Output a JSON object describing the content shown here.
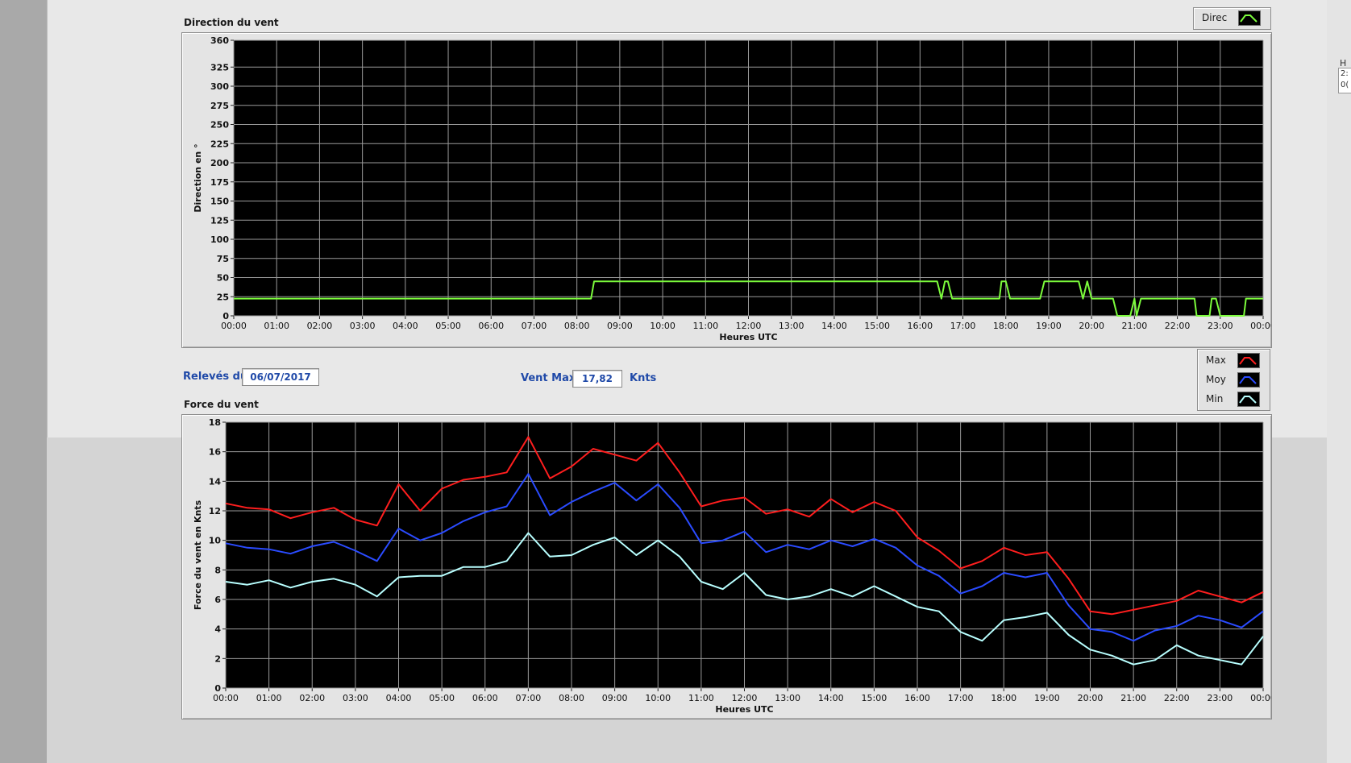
{
  "charts": {
    "direction": {
      "title": "Direction du vent",
      "legend": [
        {
          "label": "Direc",
          "color": "#7cfc3c"
        }
      ]
    },
    "force": {
      "title": "Force du vent",
      "legend": [
        {
          "label": "Max",
          "color": "#ff1e1e"
        },
        {
          "label": "Moy",
          "color": "#2a4bff"
        },
        {
          "label": "Min",
          "color": "#b8ffff"
        }
      ]
    }
  },
  "controls": {
    "releves_label": "Relevés du",
    "date_value": "06/07/2017",
    "vent_max_label": "Vent Max",
    "vent_max_value": "17,82",
    "unit_label": "Knts"
  },
  "side_strip": {
    "labels": [
      "H",
      "2:",
      "0("
    ]
  },
  "chart_data": [
    {
      "id": "direction",
      "type": "line",
      "title": "Direction du vent",
      "xlabel": "Heures UTC",
      "ylabel": "Direction en °",
      "xlim": [
        0,
        24
      ],
      "ylim": [
        0,
        360
      ],
      "xticks": [
        "00:00",
        "01:00",
        "02:00",
        "03:00",
        "04:00",
        "05:00",
        "06:00",
        "07:00",
        "08:00",
        "09:00",
        "10:00",
        "11:00",
        "12:00",
        "13:00",
        "14:00",
        "15:00",
        "16:00",
        "17:00",
        "18:00",
        "19:00",
        "20:00",
        "21:00",
        "22:00",
        "23:00",
        "00:00"
      ],
      "yticks": [
        0,
        25,
        50,
        75,
        100,
        125,
        150,
        175,
        200,
        225,
        250,
        275,
        300,
        325,
        360
      ],
      "grid": true,
      "legend_position": "top-right",
      "series": [
        {
          "name": "Direc",
          "color": "#7cfc3c",
          "x": [
            0,
            8.33,
            8.4,
            16.4,
            16.5,
            16.58,
            16.65,
            16.75,
            17.85,
            17.9,
            18.0,
            18.1,
            18.8,
            18.9,
            19.7,
            19.8,
            19.9,
            20.0,
            20.1,
            20.5,
            20.6,
            20.9,
            21.0,
            21.05,
            21.15,
            21.25,
            21.3,
            22.4,
            22.45,
            22.75,
            22.8,
            22.9,
            23.0,
            23.1,
            23.55,
            23.6,
            24.0
          ],
          "y": [
            22.5,
            22.5,
            45,
            45,
            22.5,
            45,
            45,
            22.5,
            22.5,
            45,
            45,
            22.5,
            22.5,
            45,
            45,
            22.5,
            45,
            22.5,
            22.5,
            22.5,
            0,
            0,
            22.5,
            0,
            22.5,
            22.5,
            22.5,
            22.5,
            0,
            0,
            22.5,
            22.5,
            0,
            0,
            0,
            22.5,
            22.5
          ]
        }
      ]
    },
    {
      "id": "force",
      "type": "line",
      "title": "Force du vent",
      "xlabel": "Heures UTC",
      "ylabel": "Force du vent en Knts",
      "xlim": [
        0,
        24
      ],
      "ylim": [
        0,
        18
      ],
      "xticks": [
        "00:00",
        "01:00",
        "02:00",
        "03:00",
        "04:00",
        "05:00",
        "06:00",
        "07:00",
        "08:00",
        "09:00",
        "10:00",
        "11:00",
        "12:00",
        "13:00",
        "14:00",
        "15:00",
        "16:00",
        "17:00",
        "18:00",
        "19:00",
        "20:00",
        "21:00",
        "22:00",
        "23:00",
        "00:00"
      ],
      "yticks": [
        0,
        2,
        4,
        6,
        8,
        10,
        12,
        14,
        16,
        18
      ],
      "grid": true,
      "legend_position": "top-right",
      "series": [
        {
          "name": "Max",
          "color": "#ff1e1e",
          "x": [
            0,
            0.5,
            1,
            1.5,
            2,
            2.5,
            3,
            3.5,
            4,
            4.5,
            5,
            5.5,
            6,
            6.5,
            7,
            7.5,
            8,
            8.5,
            9,
            9.5,
            10,
            10.5,
            11,
            11.5,
            12,
            12.5,
            13,
            13.5,
            14,
            14.5,
            15,
            15.5,
            16,
            16.5,
            17,
            17.5,
            18,
            18.5,
            19,
            19.5,
            20,
            20.5,
            21,
            21.5,
            22,
            22.5,
            23,
            23.5,
            24
          ],
          "y": [
            12.5,
            12.2,
            12.1,
            11.5,
            11.9,
            12.2,
            11.4,
            11.0,
            13.8,
            12.0,
            13.5,
            14.1,
            14.3,
            14.6,
            17.0,
            14.2,
            15.0,
            16.2,
            15.8,
            15.4,
            16.6,
            14.6,
            12.3,
            12.7,
            12.9,
            11.8,
            12.1,
            11.6,
            12.8,
            11.9,
            12.6,
            12.0,
            10.2,
            9.3,
            8.1,
            8.6,
            9.5,
            9.0,
            9.2,
            7.4,
            5.2,
            5.0,
            5.3,
            5.6,
            5.9,
            6.6,
            6.2,
            5.8,
            6.5
          ]
        },
        {
          "name": "Moy",
          "color": "#2a4bff",
          "x": [
            0,
            0.5,
            1,
            1.5,
            2,
            2.5,
            3,
            3.5,
            4,
            4.5,
            5,
            5.5,
            6,
            6.5,
            7,
            7.5,
            8,
            8.5,
            9,
            9.5,
            10,
            10.5,
            11,
            11.5,
            12,
            12.5,
            13,
            13.5,
            14,
            14.5,
            15,
            15.5,
            16,
            16.5,
            17,
            17.5,
            18,
            18.5,
            19,
            19.5,
            20,
            20.5,
            21,
            21.5,
            22,
            22.5,
            23,
            23.5,
            24
          ],
          "y": [
            9.8,
            9.5,
            9.4,
            9.1,
            9.6,
            9.9,
            9.3,
            8.6,
            10.8,
            10.0,
            10.5,
            11.3,
            11.9,
            12.3,
            14.5,
            11.7,
            12.6,
            13.3,
            13.9,
            12.7,
            13.8,
            12.2,
            9.8,
            10.0,
            10.6,
            9.2,
            9.7,
            9.4,
            10.0,
            9.6,
            10.1,
            9.5,
            8.3,
            7.6,
            6.4,
            6.9,
            7.8,
            7.5,
            7.8,
            5.6,
            4.0,
            3.8,
            3.2,
            3.9,
            4.2,
            4.9,
            4.6,
            4.1,
            5.2
          ]
        },
        {
          "name": "Min",
          "color": "#b8ffff",
          "x": [
            0,
            0.5,
            1,
            1.5,
            2,
            2.5,
            3,
            3.5,
            4,
            4.5,
            5,
            5.5,
            6,
            6.5,
            7,
            7.5,
            8,
            8.5,
            9,
            9.5,
            10,
            10.5,
            11,
            11.5,
            12,
            12.5,
            13,
            13.5,
            14,
            14.5,
            15,
            15.5,
            16,
            16.5,
            17,
            17.5,
            18,
            18.5,
            19,
            19.5,
            20,
            20.5,
            21,
            21.5,
            22,
            22.5,
            23,
            23.5,
            24
          ],
          "y": [
            7.2,
            7.0,
            7.3,
            6.8,
            7.2,
            7.4,
            7.0,
            6.2,
            7.5,
            7.6,
            7.6,
            8.2,
            8.2,
            8.6,
            10.5,
            8.9,
            9.0,
            9.7,
            10.2,
            9.0,
            10.0,
            8.9,
            7.2,
            6.7,
            7.8,
            6.3,
            6.0,
            6.2,
            6.7,
            6.2,
            6.9,
            6.2,
            5.5,
            5.2,
            3.8,
            3.2,
            4.6,
            4.8,
            5.1,
            3.6,
            2.6,
            2.2,
            1.6,
            1.9,
            2.9,
            2.2,
            1.9,
            1.6,
            3.5
          ]
        }
      ]
    }
  ]
}
